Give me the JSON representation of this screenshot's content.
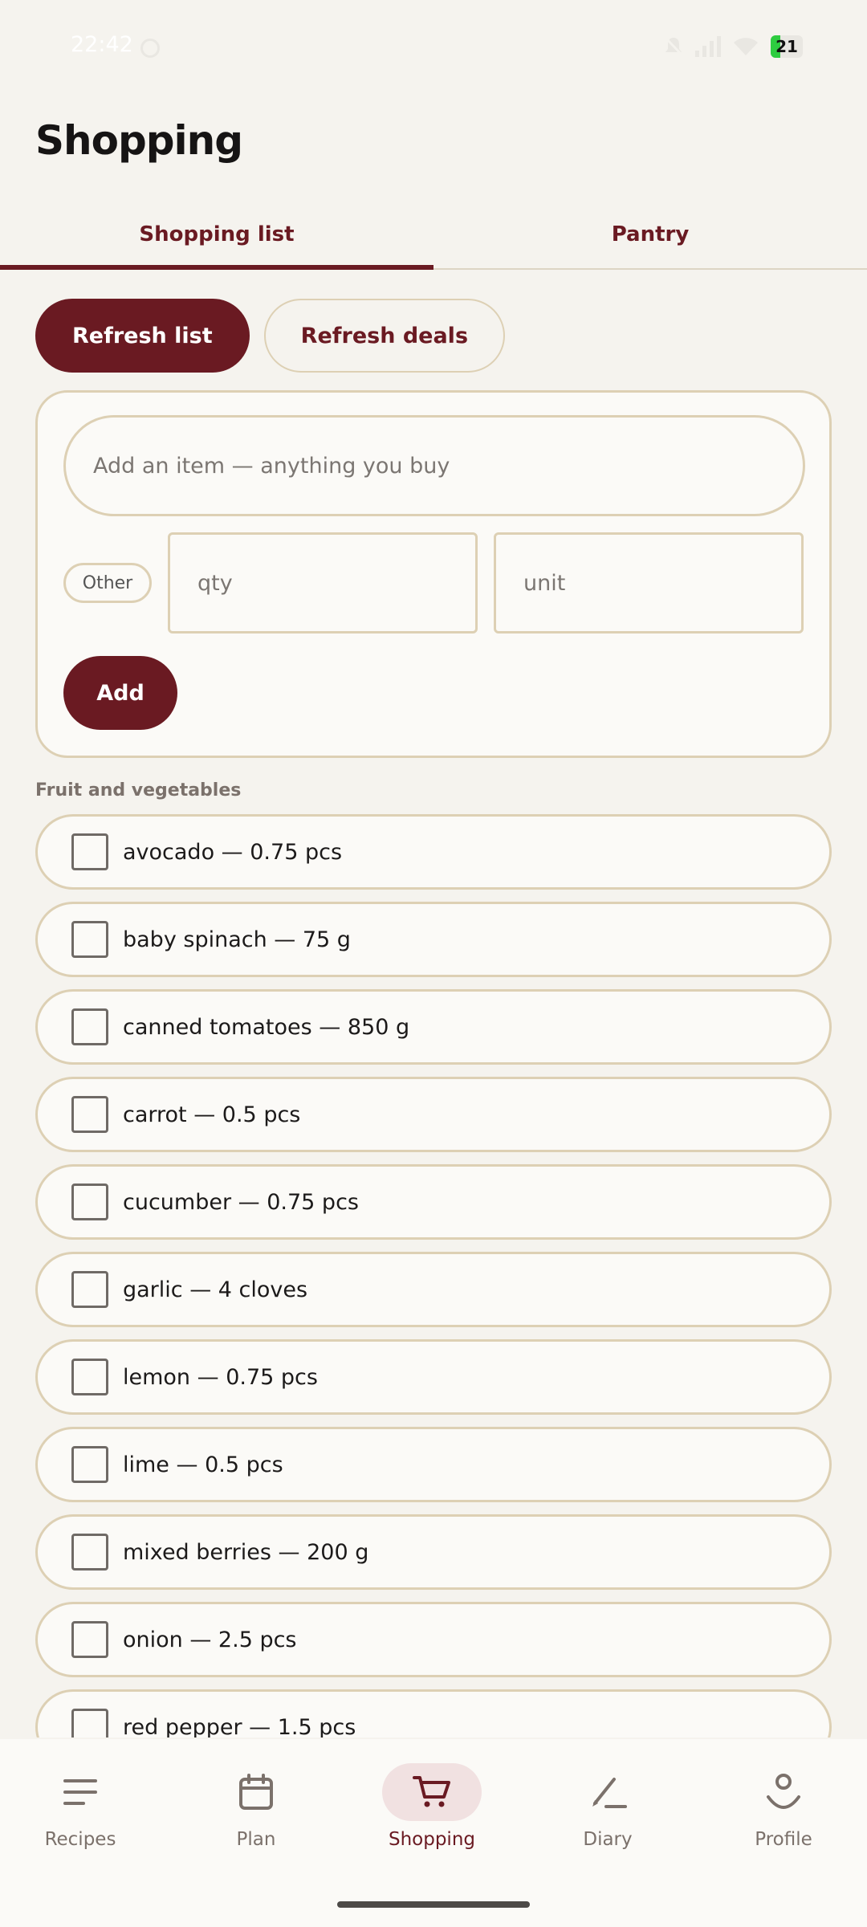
{
  "status_bar": {
    "time": "22:42",
    "battery": "21"
  },
  "header": {
    "title": "Shopping"
  },
  "tabs": [
    {
      "label": "Shopping list",
      "active": true
    },
    {
      "label": "Pantry",
      "active": false
    }
  ],
  "actions": {
    "refresh_list": "Refresh list",
    "refresh_deals": "Refresh deals"
  },
  "add_form": {
    "item_placeholder": "Add an item — anything you buy",
    "category": "Other",
    "qty_placeholder": "qty",
    "unit_placeholder": "unit",
    "add_label": "Add"
  },
  "section": {
    "title": "Fruit and vegetables"
  },
  "items": [
    {
      "label": "avocado — 0.75 pcs",
      "checked": false
    },
    {
      "label": "baby spinach — 75 g",
      "checked": false
    },
    {
      "label": "canned tomatoes — 850 g",
      "checked": false
    },
    {
      "label": "carrot — 0.5 pcs",
      "checked": false
    },
    {
      "label": "cucumber — 0.75 pcs",
      "checked": false
    },
    {
      "label": "garlic — 4 cloves",
      "checked": false
    },
    {
      "label": "lemon — 0.75 pcs",
      "checked": false
    },
    {
      "label": "lime — 0.5 pcs",
      "checked": false
    },
    {
      "label": "mixed berries — 200 g",
      "checked": false
    },
    {
      "label": "onion — 2.5 pcs",
      "checked": false
    },
    {
      "label": "red pepper — 1.5 pcs",
      "checked": false
    }
  ],
  "nav": [
    {
      "label": "Recipes",
      "icon": "menu-icon",
      "active": false
    },
    {
      "label": "Plan",
      "icon": "calendar-icon",
      "active": false
    },
    {
      "label": "Shopping",
      "icon": "cart-icon",
      "active": true
    },
    {
      "label": "Diary",
      "icon": "pencil-icon",
      "active": false
    },
    {
      "label": "Profile",
      "icon": "person-icon",
      "active": false
    }
  ],
  "colors": {
    "accent": "#6a1a22",
    "border": "#ddd0b4",
    "background": "#f5f3ee"
  }
}
